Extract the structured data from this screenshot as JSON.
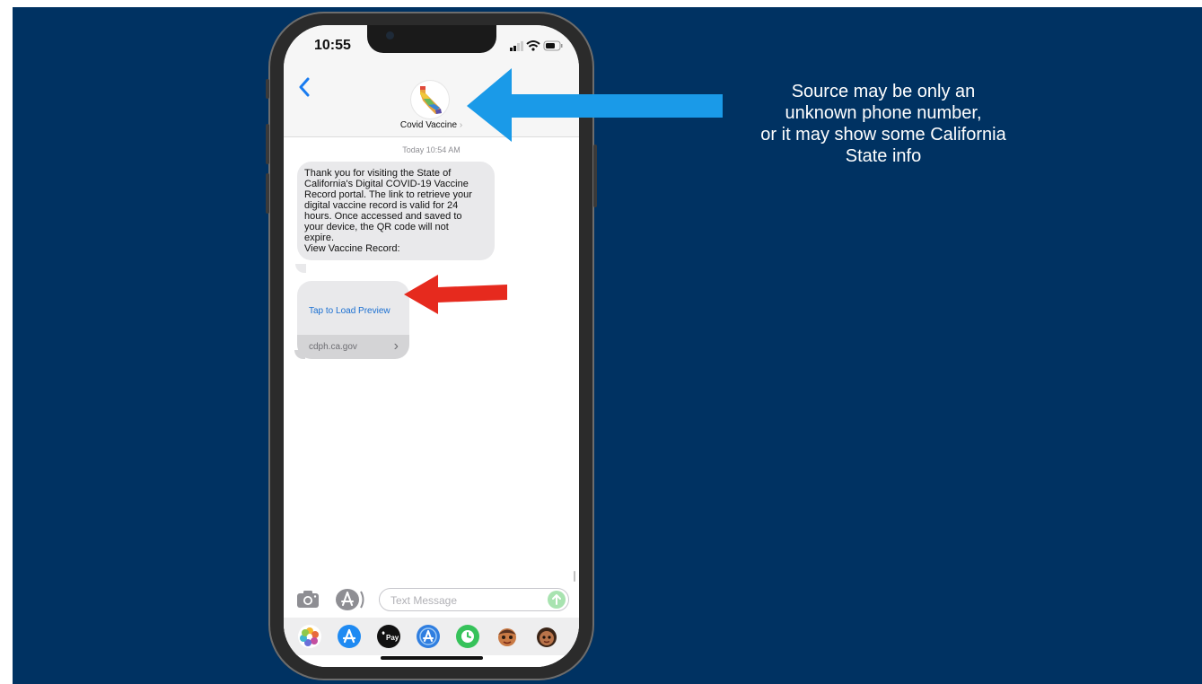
{
  "callout": {
    "lines": [
      "Source may be only an",
      "unknown phone number,",
      "or it may show some California",
      "State info"
    ]
  },
  "colors": {
    "slide_bg": "#003262",
    "blue_arrow": "#1a9ae8",
    "red_arrow": "#e62a1e",
    "link_blue": "#1a6fd1"
  },
  "phone": {
    "status_time": "10:55",
    "contact_name": "Covid Vaccine",
    "contact_chevron": "›",
    "timestamp": "Today 10:54 AM",
    "message_lines": [
      "Thank you for visiting the State of",
      "California's Digital COVID-19 Vaccine",
      "Record portal. The link to retrieve your",
      "digital vaccine record is valid for 24",
      "hours. Once accessed and saved to",
      "your device, the QR code will not",
      "expire.",
      "View Vaccine Record:"
    ],
    "link_preview": {
      "tap_label": "Tap to Load Preview",
      "domain": "cdph.ca.gov",
      "arrow": "›"
    },
    "composer": {
      "placeholder": "Text Message"
    },
    "app_tray": {
      "apple_pay_label": "Pay",
      "icons": [
        "photos-icon",
        "app-store-icon",
        "apple-pay-icon",
        "app-store-alt-icon",
        "clock-icon",
        "memoji-icon",
        "memoji-alt-icon"
      ]
    }
  }
}
